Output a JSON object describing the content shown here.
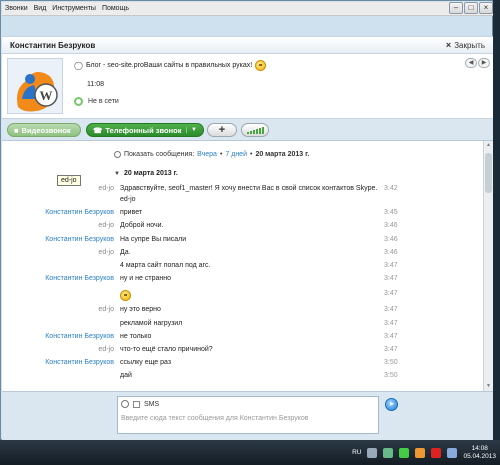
{
  "menu": [
    "Звонки",
    "Вид",
    "Инструменты",
    "Помощь"
  ],
  "window_controls": [
    "–",
    "□",
    "×"
  ],
  "header": {
    "contact_name": "Константин Безруков",
    "close_label": "Закрыть",
    "close_symbol": "×"
  },
  "profile": {
    "mood": "Блог - seo-site.proВаши сайты в правильных руках!",
    "local_time": "11:08",
    "status": "Не в сети",
    "nav_prev": "◀",
    "nav_next": "▶"
  },
  "call_bar": {
    "video_label": "Видеозвонок",
    "call_label": "Телефонный звонок",
    "add_symbol": "+"
  },
  "history": {
    "label": "Показать сообщения:",
    "option_yesterday": "Вчера",
    "option_7days": "7 дней",
    "option_date": "20 марта 2013 г."
  },
  "date_header": "20 марта 2013 г.",
  "messages": [
    {
      "sender": "ed-jo",
      "text": "Здравствуйте, seof1_master! Я хочу внести Вас в свой список контактов Skype.",
      "time": "3:42"
    },
    {
      "sender": "",
      "text": "ed-jo",
      "time": ""
    },
    {
      "sender": "Константин Безруков",
      "text": "привет",
      "time": "3:45"
    },
    {
      "sender": "ed-jo",
      "text": "Доброй ночи.",
      "time": "3:46"
    },
    {
      "sender": "Константин Безруков",
      "text": "На супре Вы писали",
      "time": "3:46"
    },
    {
      "sender": "ed-jo",
      "text": "Да.",
      "time": "3:46"
    },
    {
      "sender": "",
      "text": "4 марта сайт попал под агс.",
      "time": "3:47"
    },
    {
      "sender": "Константин Безруков",
      "text": "ну и не странно",
      "time": "3:47"
    },
    {
      "sender": "",
      "text": "",
      "time": "3:47"
    },
    {
      "sender": "ed-jo",
      "text": "ну это верно",
      "time": "3:47"
    },
    {
      "sender": "",
      "text": "рекламой нагрузил",
      "time": "3:47"
    },
    {
      "sender": "Константин Безруков",
      "text": "не только",
      "time": "3:47"
    },
    {
      "sender": "ed-jo",
      "text": "что-то ещё стало причиной?",
      "time": "3:47"
    },
    {
      "sender": "Константин Безруков",
      "text": "ссылку еще раз",
      "time": "3:50"
    },
    {
      "sender": "",
      "text": "дай",
      "time": "3:50"
    }
  ],
  "tooltip": "ed-jo",
  "composer": {
    "sms_label": "SMS",
    "placeholder": "Введите сюда текст сообщения для Константин Безруков"
  },
  "taskbar": {
    "language": "RU",
    "time": "14:08",
    "date": "05.04.2013"
  }
}
